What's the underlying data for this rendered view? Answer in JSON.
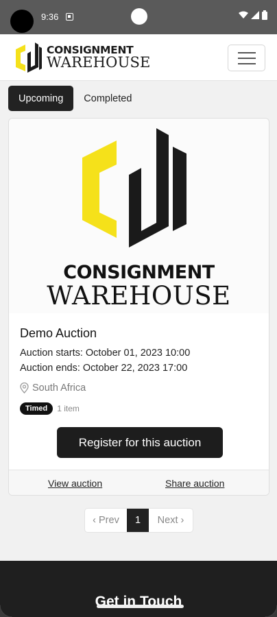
{
  "status_bar": {
    "time": "9:36"
  },
  "header": {
    "logo_line1": "CONSIGNMENT",
    "logo_line2": "WAREHOUSE",
    "logo_monogram_color": "#F5E11A"
  },
  "tabs": [
    {
      "label": "Upcoming",
      "active": true
    },
    {
      "label": "Completed",
      "active": false
    }
  ],
  "auction": {
    "image": {
      "line1": "CONSIGNMENT",
      "line2": "WAREHOUSE"
    },
    "title": "Demo Auction",
    "starts": "Auction starts: October 01, 2023 10:00",
    "ends": "Auction ends: October 22, 2023 17:00",
    "location": "South Africa",
    "badge": "Timed",
    "items": "1 item",
    "register_label": "Register for this auction",
    "view_label": "View auction",
    "share_label": "Share auction"
  },
  "pagination": {
    "prev": "‹ Prev",
    "current": "1",
    "next": "Next ›"
  },
  "contact": {
    "title": "Get in Touch"
  },
  "icons": {
    "menu": "hamburger-menu-icon",
    "location": "map-pin-icon",
    "wifi": "wifi-icon",
    "signal": "cell-signal-icon",
    "battery": "battery-icon"
  },
  "colors": {
    "brand_yellow": "#F5E11A",
    "brand_dark": "#1D1D1D"
  }
}
